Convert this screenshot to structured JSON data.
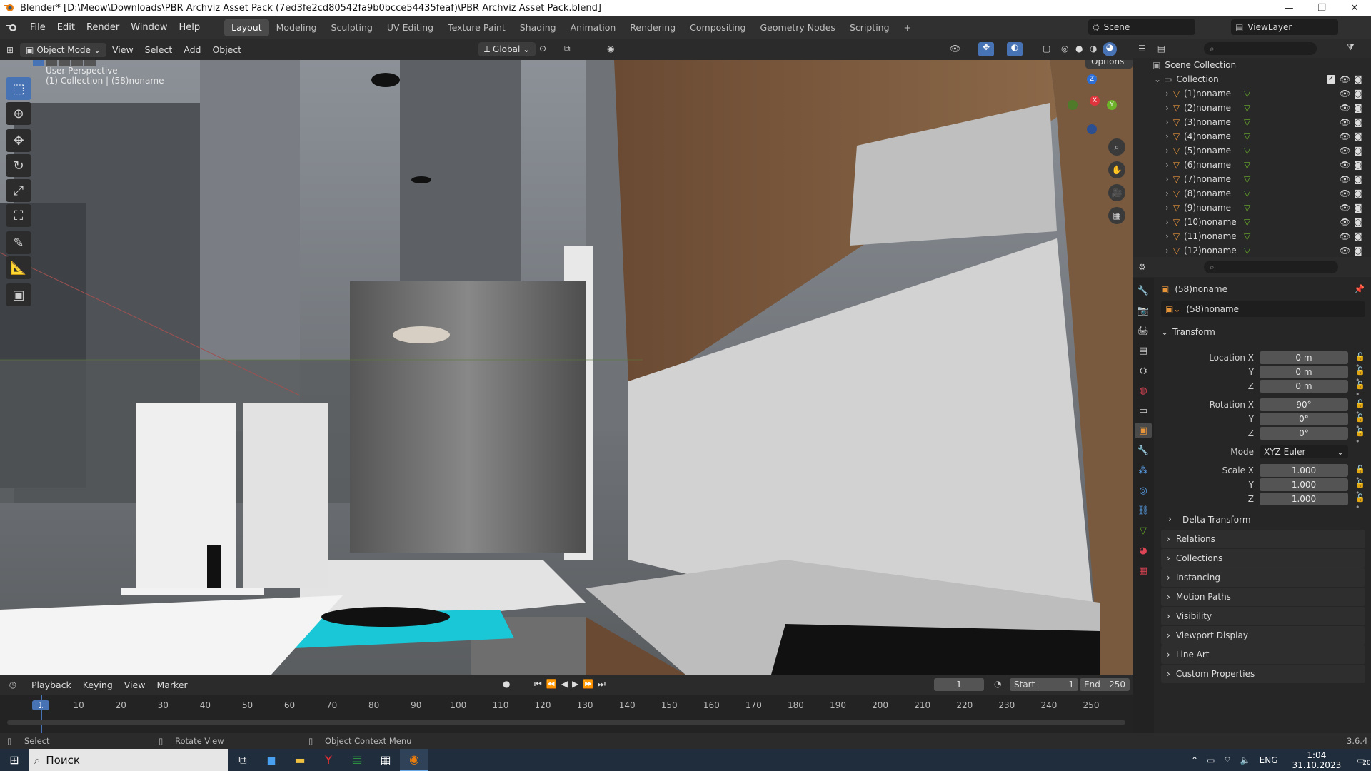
{
  "window": {
    "title": "Blender* [D:\\Meow\\Downloads\\PBR Archviz Asset Pack (7ed3fe2cd80542fa9b0bcce54435feaf)\\PBR Archviz Asset Pack.blend]",
    "minimize": "—",
    "maximize": "❐",
    "close": "✕"
  },
  "menubar": {
    "menus": [
      "File",
      "Edit",
      "Render",
      "Window",
      "Help"
    ],
    "workspaces": [
      "Layout",
      "Modeling",
      "Sculpting",
      "UV Editing",
      "Texture Paint",
      "Shading",
      "Animation",
      "Rendering",
      "Compositing",
      "Geometry Nodes",
      "Scripting"
    ],
    "active_workspace": "Layout",
    "add_workspace": "+",
    "scene": "Scene",
    "view_layer": "ViewLayer"
  },
  "viewport_header": {
    "mode": "Object Mode",
    "menus": [
      "View",
      "Select",
      "Add",
      "Object"
    ],
    "orientation": "Global",
    "options": "Options"
  },
  "viewport": {
    "perspective_label": "User Perspective",
    "collection_label": "(1) Collection | (58)noname",
    "gizmo_axes": {
      "x": "X",
      "y": "Y",
      "z": "Z"
    }
  },
  "toolbar": {
    "tools": [
      "select-box",
      "cursor",
      "move",
      "rotate",
      "scale",
      "transform",
      "annotate",
      "measure",
      "add-cube"
    ]
  },
  "timeline": {
    "menus": [
      "Playback",
      "Keying",
      "View",
      "Marker"
    ],
    "current_frame": "1",
    "start_label": "Start",
    "start": "1",
    "end_label": "End",
    "end": "250",
    "ticks": [
      "1",
      "10",
      "20",
      "30",
      "40",
      "50",
      "60",
      "70",
      "80",
      "90",
      "100",
      "110",
      "120",
      "130",
      "140",
      "150",
      "160",
      "170",
      "180",
      "190",
      "200",
      "210",
      "220",
      "230",
      "240",
      "250"
    ]
  },
  "statusbar": {
    "select": "Select",
    "rotate": "Rotate View",
    "context": "Object Context Menu",
    "version": "3.6.4"
  },
  "outliner": {
    "scene_collection": "Scene Collection",
    "collection": "Collection",
    "items": [
      "(1)noname",
      "(2)noname",
      "(3)noname",
      "(4)noname",
      "(5)noname",
      "(6)noname",
      "(7)noname",
      "(8)noname",
      "(9)noname",
      "(10)noname",
      "(11)noname",
      "(12)noname"
    ]
  },
  "properties": {
    "object_name": "(58)noname",
    "datablock": "(58)noname",
    "transform_label": "Transform",
    "location_label": "Location X",
    "rotation_label": "Rotation X",
    "scale_label": "Scale X",
    "y_label": "Y",
    "z_label": "Z",
    "location": [
      "0 m",
      "0 m",
      "0 m"
    ],
    "rotation": [
      "90°",
      "0°",
      "0°"
    ],
    "mode_label": "Mode",
    "mode": "XYZ Euler",
    "scale": [
      "1.000",
      "1.000",
      "1.000"
    ],
    "delta": "Delta Transform",
    "panels": [
      "Relations",
      "Collections",
      "Instancing",
      "Motion Paths",
      "Visibility",
      "Viewport Display",
      "Line Art",
      "Custom Properties"
    ]
  },
  "taskbar": {
    "search": "Поиск",
    "lang": "ENG",
    "time": "1:04",
    "date": "31.10.2023",
    "notif": "20"
  },
  "colors": {
    "accent": "#4772b3",
    "title_bg": "#ffffff",
    "orange": "#e8953a"
  }
}
